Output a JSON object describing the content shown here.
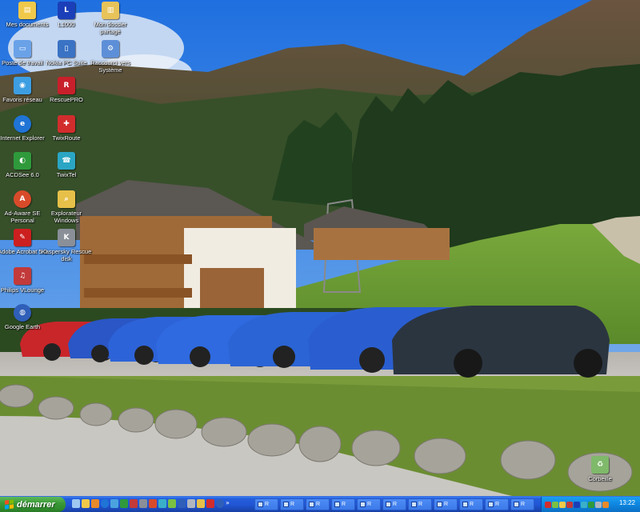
{
  "desktop": {
    "icons": [
      {
        "label": "Mes documents",
        "icon": "folder-documents-icon",
        "color": "#f1c94a"
      },
      {
        "label": "L1000",
        "icon": "app-l-icon",
        "color": "#1b3fb8"
      },
      {
        "label": "Mon dossier partagé",
        "icon": "shared-folder-icon",
        "color": "#e8c35a"
      },
      {
        "label": "Poste de travail",
        "icon": "computer-icon",
        "color": "#6aa2e8"
      },
      {
        "label": "Nokia PC Suite",
        "icon": "nokia-icon",
        "color": "#3a72c4"
      },
      {
        "label": "Raccourci vers Système",
        "icon": "shortcut-system-icon",
        "color": "#5d8fd8"
      },
      {
        "label": "Favoris réseau",
        "icon": "network-icon",
        "color": "#3d9ee2"
      },
      {
        "label": "RescuePRO",
        "icon": "rescuepro-icon",
        "color": "#c8202a"
      },
      {
        "label": "Internet Explorer",
        "icon": "internet-explorer-icon",
        "color": "#1f74d6"
      },
      {
        "label": "TwixRoute",
        "icon": "twixroute-icon",
        "color": "#d22d2d"
      },
      {
        "label": "ACDSee 6.0",
        "icon": "acdsee-icon",
        "color": "#2f9a3c"
      },
      {
        "label": "TwixTel",
        "icon": "twixtel-icon",
        "color": "#2aa6c4"
      },
      {
        "label": "Ad-Aware SE Personal",
        "icon": "adaware-icon",
        "color": "#d84b2a"
      },
      {
        "label": "Explorateur Windows",
        "icon": "explorer-icon",
        "color": "#e7c04a"
      },
      {
        "label": "Adobe Acrobat 5.0",
        "icon": "acrobat-icon",
        "color": "#cc1f1f"
      },
      {
        "label": "Kaspersky Rescue disk",
        "icon": "kaspersky-icon",
        "color": "#8a8f98"
      },
      {
        "label": "Philips VLounge",
        "icon": "philips-icon",
        "color": "#c23a3a"
      },
      {
        "label": "Google Earth",
        "icon": "google-earth-icon",
        "color": "#2f5fb8"
      },
      {
        "label": "Corbeille",
        "icon": "recycle-bin-icon",
        "color": "#7fb96a"
      }
    ]
  },
  "taskbar": {
    "start_label": "démarrer",
    "clock": "13:22",
    "task_label": "R",
    "tasks_count_visible": 11,
    "colors": {
      "taskbar": "#245edb",
      "start": "#3c9a38",
      "tray": "#0f86e0"
    }
  }
}
